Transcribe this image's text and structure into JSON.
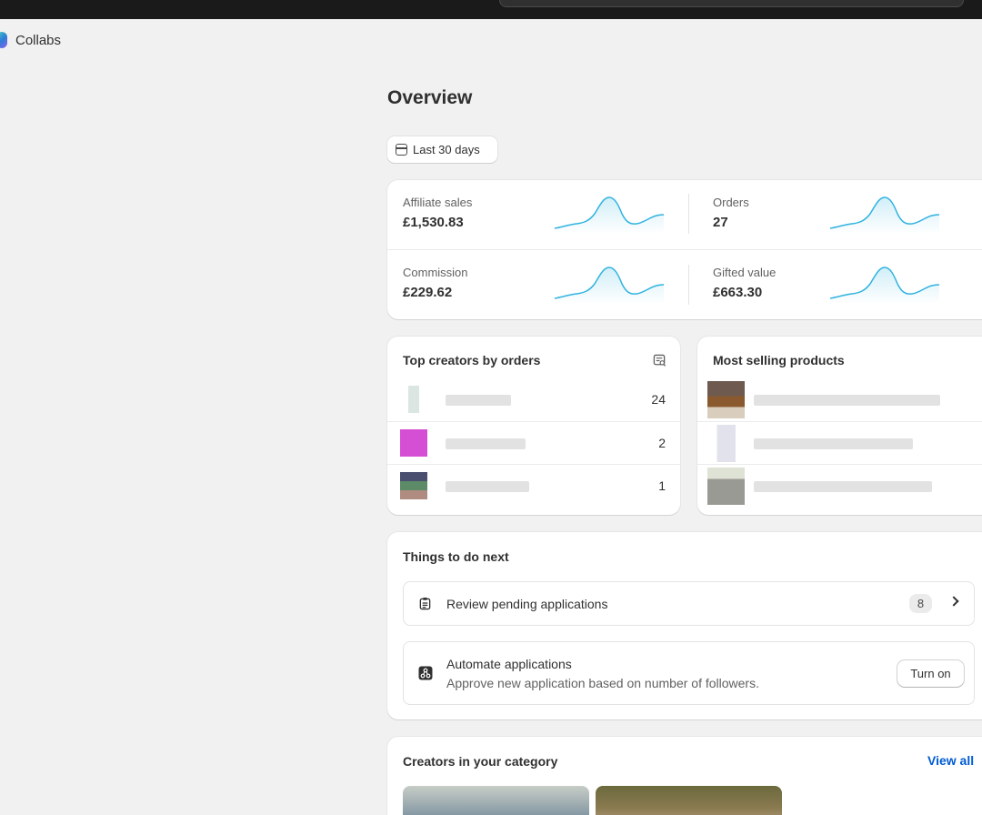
{
  "app": {
    "name": "Collabs"
  },
  "page": {
    "title": "Overview"
  },
  "date_filter": {
    "label": "Last 30 days"
  },
  "metrics": [
    {
      "label": "Affiliate sales",
      "value": "£1,530.83"
    },
    {
      "label": "Orders",
      "value": "27"
    },
    {
      "label": "Commission",
      "value": "£229.62"
    },
    {
      "label": "Gifted value",
      "value": "£663.30"
    }
  ],
  "top_creators": {
    "title": "Top creators by orders",
    "rows": [
      {
        "count": "24"
      },
      {
        "count": "2"
      },
      {
        "count": "1"
      }
    ]
  },
  "products": {
    "title": "Most selling products"
  },
  "todo": {
    "title": "Things to do next",
    "review": {
      "label": "Review pending applications",
      "badge": "8"
    },
    "automate": {
      "label": "Automate applications",
      "description": "Approve new application based on number of followers.",
      "button": "Turn on"
    }
  },
  "category": {
    "title": "Creators in your category",
    "view_all": "View all"
  },
  "colors": {
    "accent_link": "#005bd3",
    "sparkline": "#2fb3e0",
    "topbar": "#1a1a1a"
  },
  "icons": [
    "calendar-icon",
    "inspect-chart-icon",
    "clipboard-icon",
    "automation-icon",
    "chevron-right-icon"
  ]
}
